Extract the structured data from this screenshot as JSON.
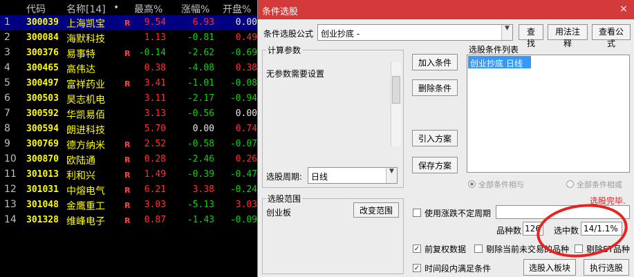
{
  "stock_list": {
    "headers": {
      "code": "代码",
      "name": "名称[14]",
      "dot": "•",
      "high": "最高%",
      "change": "涨幅%",
      "open": "开盘%"
    },
    "rows": [
      {
        "idx": "1",
        "code": "300039",
        "name": "上海凯宝",
        "r": "R",
        "high": "9.54",
        "change": "6.93",
        "open": "0.00"
      },
      {
        "idx": "2",
        "code": "300084",
        "name": "海默科技",
        "r": "",
        "high": "1.13",
        "change": "-0.81",
        "open": "0.49"
      },
      {
        "idx": "3",
        "code": "300376",
        "name": "易事特",
        "r": "R",
        "high": "-0.14",
        "change": "-2.62",
        "open": "-0.69"
      },
      {
        "idx": "4",
        "code": "300465",
        "name": "高伟达",
        "r": "",
        "high": "0.38",
        "change": "-4.08",
        "open": "0.38"
      },
      {
        "idx": "5",
        "code": "300497",
        "name": "富祥药业",
        "r": "R",
        "high": "3.41",
        "change": "-1.01",
        "open": "-0.08"
      },
      {
        "idx": "6",
        "code": "300503",
        "name": "昊志机电",
        "r": "",
        "high": "3.11",
        "change": "-2.17",
        "open": "-0.94"
      },
      {
        "idx": "7",
        "code": "300592",
        "name": "华凯易佰",
        "r": "",
        "high": "3.13",
        "change": "-0.56",
        "open": "0.00"
      },
      {
        "idx": "8",
        "code": "300594",
        "name": "朗进科技",
        "r": "",
        "high": "5.70",
        "change": "0.00",
        "open": "0.74"
      },
      {
        "idx": "9",
        "code": "300769",
        "name": "德方纳米",
        "r": "R",
        "high": "2.52",
        "change": "-0.58",
        "open": "-0.07"
      },
      {
        "idx": "10",
        "code": "300870",
        "name": "欧陆通",
        "r": "R",
        "high": "0.28",
        "change": "-2.46",
        "open": "0.26"
      },
      {
        "idx": "11",
        "code": "301013",
        "name": "利和兴",
        "r": "R",
        "high": "1.49",
        "change": "-0.39",
        "open": "-0.47"
      },
      {
        "idx": "12",
        "code": "301031",
        "name": "中熔电气",
        "r": "R",
        "high": "6.21",
        "change": "3.38",
        "open": "-0.24"
      },
      {
        "idx": "13",
        "code": "301048",
        "name": "金鹰重工",
        "r": "R",
        "high": "3.03",
        "change": "-5.13",
        "open": "3.03"
      },
      {
        "idx": "14",
        "code": "301328",
        "name": "维峰电子",
        "r": "R",
        "high": "0.87",
        "change": "-1.43",
        "open": "-0.09"
      }
    ]
  },
  "dialog": {
    "title": "条件选股",
    "close_icon": "×",
    "formula_label": "条件选股公式",
    "formula_value": "创业抄底       -",
    "find_btn": "查找",
    "usage_btn": "用法注释",
    "view_formula_btn": "查看公式",
    "params_group": "计算参数",
    "params_text": "无参数需要设置",
    "add_cond_btn": "加入条件",
    "del_cond_btn": "删除条件",
    "import_plan_btn": "引入方案",
    "save_plan_btn": "保存方案",
    "cond_list_label": "选股条件列表",
    "cond_list_items": [
      "创业抄底  日线"
    ],
    "period_label": "选股周期:",
    "period_value": "日线",
    "radio_and": "全部条件相与",
    "radio_or": "全部条件相或",
    "status_text": "选股完毕.",
    "range_group": "选股范围",
    "range_value": "创业板",
    "change_range_btn": "改变范围",
    "uncertain_period_label": "使用涨跌不定周期",
    "varieties_label": "品种数",
    "varieties_value": "126",
    "selected_label": "选中数",
    "selected_value": "14/1.1%",
    "fq_label": "前复权数据",
    "exclude_label": "剔除当前未交易的品种",
    "exclude_st_label": "剔除ST品种",
    "time_satisfy_label": "时间段内满足条件",
    "to_block_btn": "选股入板块",
    "execute_btn": "执行选股"
  },
  "colors": {
    "up": "#ff3030",
    "down": "#10d010",
    "title_bar": "#d33b3b",
    "selection": "#3399ff",
    "highlight_circle": "#e8221c"
  }
}
